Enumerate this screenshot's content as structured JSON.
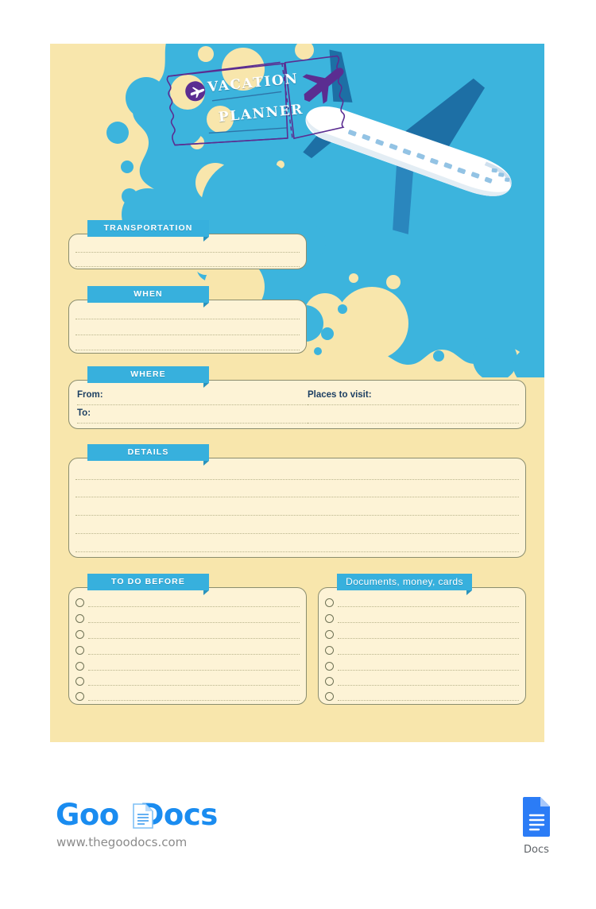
{
  "document": {
    "title_line1": "VACATION",
    "title_line2": "PLANNER",
    "ticket_icon": "airplane-icon",
    "stub_icon": "airplane-silhouette-icon"
  },
  "colors": {
    "page_background": "#ffffff",
    "sheet_background": "#f8e6ac",
    "blob_blue": "#3cb4dd",
    "tab_blue": "#37b0dd",
    "field_cream": "#fdf3d6",
    "field_border": "#8a8d6e",
    "dotted_line": "#b9b48c",
    "ticket_purple": "#5b2d91",
    "plane_dark_blue": "#1d6fa5",
    "label_navy": "#1c3f63",
    "logo_blue": "#1a8cf0",
    "docs_icon_blue": "#2b7cf6",
    "url_gray": "#8b8b8b"
  },
  "sections": [
    {
      "id": "transportation",
      "label": "TRANSPORTATION",
      "type": "lined",
      "lines": 2
    },
    {
      "id": "when",
      "label": "WHEN",
      "type": "lined",
      "lines": 3
    },
    {
      "id": "where",
      "label": "WHERE",
      "type": "fields",
      "fields": [
        {
          "name": "from",
          "label": "From:"
        },
        {
          "name": "to",
          "label": "To:"
        },
        {
          "name": "places_to_visit",
          "label": "Places to visit:"
        }
      ]
    },
    {
      "id": "details",
      "label": "DETAILS",
      "type": "lined",
      "lines": 5
    },
    {
      "id": "to_do_before",
      "label": "TO DO BEFORE",
      "type": "checklist",
      "items": 7
    },
    {
      "id": "documents_money_cards",
      "label": "Documents, money, cards",
      "type": "checklist",
      "items": 7
    }
  ],
  "footer": {
    "logo_part1": "Goo",
    "logo_part2": "Docs",
    "url": "www.thegoodocs.com",
    "docs_badge_label": "Docs",
    "docs_badge_icon": "google-docs-icon"
  }
}
